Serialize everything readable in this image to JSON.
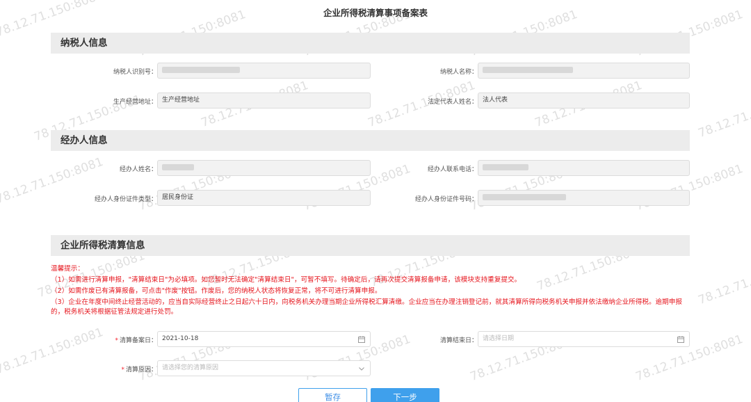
{
  "page": {
    "title": "企业所得税清算事项备案表"
  },
  "sections": {
    "taxpayer": {
      "title": "纳税人信息",
      "taxpayer_id_label": "纳税人识别号：",
      "taxpayer_name_label": "纳税人名称：",
      "address_label": "生产经营地址：",
      "address_value": "生产经营地址",
      "legal_rep_label": "法定代表人姓名：",
      "legal_rep_value": "法人代表"
    },
    "agent": {
      "title": "经办人信息",
      "name_label": "经办人姓名：",
      "phone_label": "经办人联系电话：",
      "id_type_label": "经办人身份证件类型：",
      "id_type_value": "居民身份证",
      "id_number_label": "经办人身份证件号码："
    },
    "liquidation": {
      "title": "企业所得税清算信息",
      "tips_title": "温馨提示：",
      "tip1": "（1）如需进行清算申报，\"清算结束日\"为必填项。如您暂时无法确定\"清算结束日\"，可暂不填写。待确定后，请再次提交清算报备申请，该模块支持重复提交。",
      "tip2": "（2）如需作废已有清算报备，可点击\"作废\"按钮。作废后，您的纳税人状态将恢复正常，将不可进行清算申报。",
      "tip3": "（3）企业在年度中间终止经营活动的，应当自实际经营终止之日起六十日内，向税务机关办理当期企业所得税汇算清缴。企业应当在办理注销登记前，就其清算所得向税务机关申报并依法缴纳企业所得税。逾期申报的，税务机关将根据征管法规定进行处罚。",
      "record_date_label": "清算备案日：",
      "record_date_value": "2021-10-18",
      "end_date_label": "清算结束日：",
      "end_date_placeholder": "请选择日期",
      "reason_label": "清算原因：",
      "reason_placeholder": "请选择您的清算原因",
      "required_mark": "*"
    }
  },
  "buttons": {
    "save_draft": "暂存",
    "next_step": "下一步"
  },
  "watermark_text": "78.12.71.150:8081",
  "colors": {
    "accent": "#3fa0ec",
    "warning": "#e6151d",
    "header_bg": "#ececec"
  },
  "icons": {
    "date_picker": "calendar-icon",
    "select": "chevron-down-icon"
  }
}
